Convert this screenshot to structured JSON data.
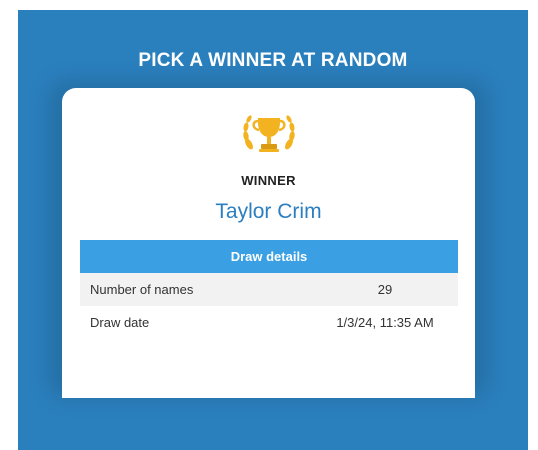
{
  "title": "PICK A WINNER AT RANDOM",
  "winner": {
    "label": "WINNER",
    "name": "Taylor Crim",
    "icon": "trophy-icon"
  },
  "details": {
    "header": "Draw details",
    "rows": [
      {
        "label": "Number of names",
        "value": "29"
      },
      {
        "label": "Draw date",
        "value": "1/3/24, 11:35 AM"
      }
    ]
  },
  "colors": {
    "background": "#2a7fbd",
    "accent": "#3aa0e3",
    "name": "#2b7fc0",
    "trophy_gold": "#f3b321"
  }
}
